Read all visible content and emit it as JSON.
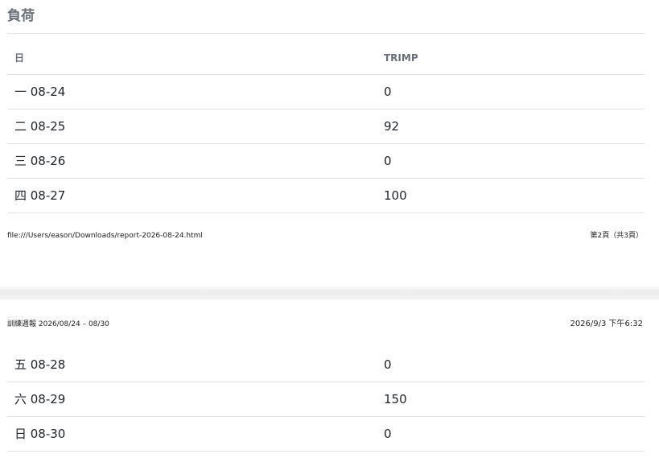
{
  "section": {
    "title": "負荷"
  },
  "table": {
    "columns": [
      "日",
      "TRIMP"
    ],
    "page1_rows": [
      {
        "day": "一 08-24",
        "trimp": "0"
      },
      {
        "day": "二 08-25",
        "trimp": "92"
      },
      {
        "day": "三 08-26",
        "trimp": "0"
      },
      {
        "day": "四 08-27",
        "trimp": "100"
      }
    ],
    "page2_rows": [
      {
        "day": "五 08-28",
        "trimp": "0"
      },
      {
        "day": "六 08-29",
        "trimp": "150"
      },
      {
        "day": "日 08-30",
        "trimp": "0"
      }
    ]
  },
  "print_footer": {
    "url": "file:///Users/eason/Downloads/report-2026-08-24.html",
    "page_indicator": "第2頁（共3頁）"
  },
  "print_header": {
    "doc_title": "訓練週報 2026/08/24 – 08/30",
    "printed_at": "2026/9/3 下午6:32"
  }
}
